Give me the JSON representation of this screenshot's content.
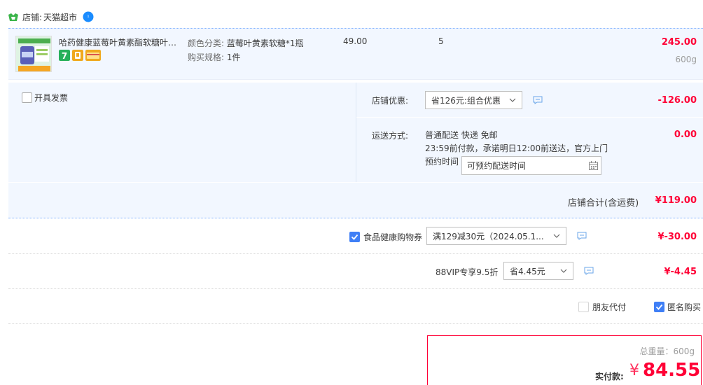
{
  "shop": {
    "prefix": "店铺:",
    "name": "天猫超市"
  },
  "item": {
    "title": "哈药健康蓝莓叶黄素酯软糖叶黄素酯软糖",
    "sku_color_label": "颜色分类:",
    "sku_color_value": "蓝莓叶黄素软糖*1瓶",
    "sku_spec_label": "购买规格:",
    "sku_spec_value": "1件",
    "price": "49.00",
    "qty": "5",
    "subtotal": "245.00",
    "weight": "600g"
  },
  "invoice": {
    "label": "开具发票",
    "checked": false
  },
  "discount": {
    "label": "店铺优惠:",
    "select": "省126元:组合优惠",
    "amount": "-126.00"
  },
  "shipping": {
    "label": "运送方式:",
    "line1": "普通配送 快递 免邮",
    "line2": "23:59前付款，承诺明日12:00前送达，官方上门",
    "reserve_label": "预约时间",
    "reserve_placeholder": "可预约配送时间",
    "amount": "0.00"
  },
  "shop_total": {
    "label": "店铺合计(含运费)",
    "value": "¥119.00"
  },
  "coupon": {
    "label": "食品健康购物券",
    "checked": true,
    "select": "满129减30元（2024.05.1...",
    "amount": "¥-30.00"
  },
  "vip": {
    "label": "88VIP专享9.5折",
    "select": "省4.45元",
    "amount": "¥-4.45"
  },
  "options": {
    "friend_pay": "朋友代付",
    "friend_pay_checked": false,
    "anonymous": "匿名购买",
    "anonymous_checked": true
  },
  "summary": {
    "weight": "总重量：600g",
    "pay_label": "实付款:",
    "currency": "¥",
    "pay_value": "84.55"
  },
  "colors": {
    "accent": "#ff0036",
    "blue": "#3f7ff6",
    "panel": "#f2f7ff"
  }
}
